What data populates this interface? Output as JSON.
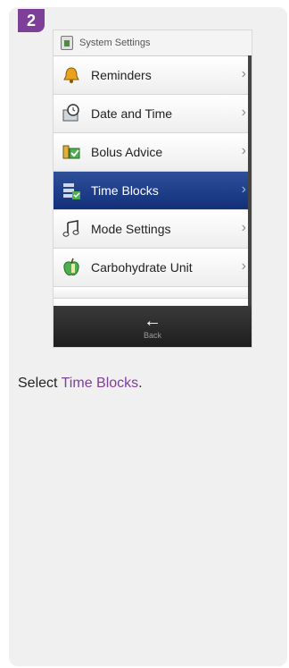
{
  "step": {
    "number": "2"
  },
  "device": {
    "header": {
      "title": "System Settings",
      "icon": "settings-meter-icon"
    },
    "items": [
      {
        "label": "Reminders",
        "icon": "bell-icon",
        "selected": false
      },
      {
        "label": "Date and Time",
        "icon": "clock-monitor-icon",
        "selected": false
      },
      {
        "label": "Bolus Advice",
        "icon": "bolus-advice-icon",
        "selected": false
      },
      {
        "label": "Time Blocks",
        "icon": "time-blocks-icon",
        "selected": true
      },
      {
        "label": "Mode Settings",
        "icon": "music-note-icon",
        "selected": false
      },
      {
        "label": "Carbohydrate Unit",
        "icon": "apple-icon",
        "selected": false
      }
    ],
    "chevron": "›",
    "nav": {
      "back_label": "Back",
      "back_glyph": "←"
    }
  },
  "instruction": {
    "prefix": "Select ",
    "highlight": "Time Blocks",
    "suffix": "."
  },
  "colors": {
    "accent": "#7d3f98",
    "selected_row": "#1f3f8a"
  }
}
